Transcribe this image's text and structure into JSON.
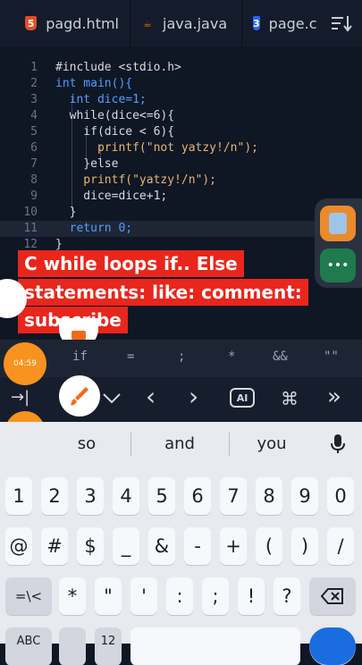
{
  "tabs": [
    {
      "label": "pagd.html",
      "icon": "html5-icon"
    },
    {
      "label": "java.java",
      "icon": "java-icon"
    },
    {
      "label": "page.c",
      "icon": "css3-icon"
    }
  ],
  "code_lines": [
    {
      "num": "1",
      "text": "#include <stdio.h>"
    },
    {
      "num": "2",
      "text": "int main(){"
    },
    {
      "num": "3",
      "text": "  int dice=1;"
    },
    {
      "num": "4",
      "text": "  while(dice<=6){"
    },
    {
      "num": "5",
      "text": "    if(dice < 6){"
    },
    {
      "num": "6",
      "text": "      printf(\"not yatzy!/n\");"
    },
    {
      "num": "7",
      "text": "    }else"
    },
    {
      "num": "8",
      "text": "    printf(\"yatzy!/n\");"
    },
    {
      "num": "9",
      "text": "    dice=dice+1;"
    },
    {
      "num": "10",
      "text": "  }"
    },
    {
      "num": "11",
      "text": "  return 0;"
    },
    {
      "num": "12",
      "text": "}"
    }
  ],
  "caption": {
    "line1": "C while loops if.. Else",
    "line2": "statements: like: comment:",
    "line3": "subscribe"
  },
  "timer": "04:59",
  "side_more": "•••",
  "symbols": [
    "if",
    "=",
    ";",
    "*",
    "&&",
    "\"\""
  ],
  "toolbar": {
    "tab": "→|",
    "ai": "AI",
    "cmd": "⌘",
    "left": "‹",
    "right": "›",
    "skip": "»"
  },
  "suggestions": [
    "so",
    "and",
    "you"
  ],
  "number_row": [
    "1",
    "2",
    "3",
    "4",
    "5",
    "6",
    "7",
    "8",
    "9",
    "0"
  ],
  "symbol_row1": [
    "@",
    "#",
    "$",
    "_",
    "&",
    "-",
    "+",
    "(",
    ")",
    "/"
  ],
  "symbol_row2": [
    "=\\<",
    "*",
    "\"",
    "'",
    ":",
    ";",
    "!",
    "?"
  ],
  "bottom_row": [
    "ABC",
    "",
    "12"
  ]
}
